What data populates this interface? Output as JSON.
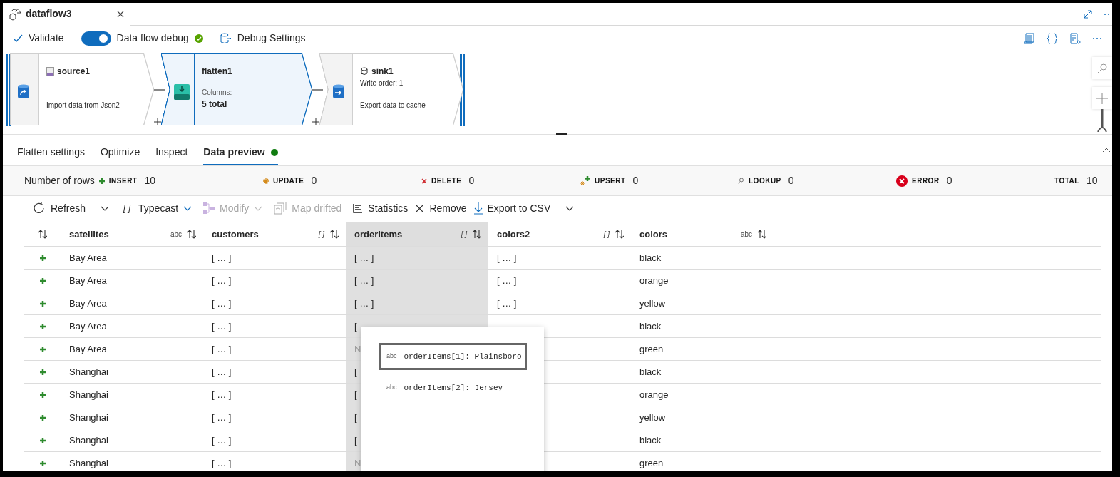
{
  "tab": {
    "title": "dataflow3"
  },
  "toolbar": {
    "validate": "Validate",
    "debug": {
      "label": "Data flow debug",
      "on": true
    },
    "settings": "Debug Settings"
  },
  "canvas": {
    "nodes": [
      {
        "kind": "source",
        "name": "source1",
        "note": "Import data from Json2",
        "selected": false
      },
      {
        "kind": "flatten",
        "name": "flatten1",
        "caption": "Columns:",
        "count": "5 total",
        "selected": true
      },
      {
        "kind": "sink",
        "name": "sink1",
        "subtitle": "Write order: 1",
        "note": "Export data to cache",
        "selected": false
      }
    ]
  },
  "panel_tabs": [
    {
      "label": "Flatten settings",
      "selected": false
    },
    {
      "label": "Optimize",
      "selected": false
    },
    {
      "label": "Inspect",
      "selected": false
    },
    {
      "label": "Data preview",
      "selected": true,
      "succeeded": true
    }
  ],
  "stats": {
    "label": "Number of rows",
    "items": [
      {
        "kind": "insert",
        "label": "INSERT",
        "value": "10"
      },
      {
        "kind": "update",
        "label": "UPDATE",
        "value": "0"
      },
      {
        "kind": "delete",
        "label": "DELETE",
        "value": "0"
      },
      {
        "kind": "upsert",
        "label": "UPSERT",
        "value": "0"
      },
      {
        "kind": "lookup",
        "label": "LOOKUP",
        "value": "0"
      },
      {
        "kind": "error",
        "label": "ERROR",
        "value": "0"
      },
      {
        "kind": "total",
        "label": "TOTAL",
        "value": "10"
      }
    ]
  },
  "preview_toolbar": [
    {
      "kind": "refresh",
      "label": "Refresh",
      "disabled": false,
      "caret": true,
      "separator": true
    },
    {
      "kind": "typecast",
      "glyph": "[ ]",
      "label": "Typecast",
      "disabled": false,
      "caret": true,
      "separator": false
    },
    {
      "kind": "modify",
      "label": "Modify",
      "disabled": true,
      "caret": true,
      "separator": false
    },
    {
      "kind": "map",
      "label": "Map drifted",
      "disabled": true
    },
    {
      "kind": "statistics",
      "label": "Statistics",
      "disabled": false
    },
    {
      "kind": "remove",
      "label": "Remove",
      "disabled": false
    },
    {
      "kind": "export",
      "label": "Export to CSV",
      "disabled": false,
      "caret": true,
      "separator": true
    }
  ],
  "table": {
    "columns": [
      {
        "label": "satellites",
        "type": "abc",
        "selected": false
      },
      {
        "label": "customers",
        "type": "[ ]",
        "selected": false
      },
      {
        "label": "orderItems",
        "type": "[ ]",
        "selected": true
      },
      {
        "label": "colors2",
        "type": "[ ]",
        "selected": false
      },
      {
        "label": "colors",
        "type": "abc",
        "selected": false
      }
    ],
    "rows": [
      {
        "kind": "insert",
        "cells": [
          "Bay Area",
          "[ … ]",
          "[ … ]",
          "[ … ]",
          "black"
        ]
      },
      {
        "kind": "insert",
        "cells": [
          "Bay Area",
          "[ … ]",
          "[ … ]",
          "[ … ]",
          "orange"
        ]
      },
      {
        "kind": "insert",
        "cells": [
          "Bay Area",
          "[ … ]",
          "[ … ]",
          "[ … ]",
          "yellow"
        ]
      },
      {
        "kind": "insert",
        "cells": [
          "Bay Area",
          "[ … ]",
          "[",
          null,
          "black"
        ]
      },
      {
        "kind": "insert",
        "cells": [
          "Bay Area",
          "[ … ]",
          "N",
          null,
          "green"
        ]
      },
      {
        "kind": "insert",
        "cells": [
          "Shanghai",
          "[ … ]",
          "[",
          null,
          "black"
        ]
      },
      {
        "kind": "insert",
        "cells": [
          "Shanghai",
          "[ … ]",
          "[",
          null,
          "orange"
        ]
      },
      {
        "kind": "insert",
        "cells": [
          "Shanghai",
          "[ … ]",
          "[",
          null,
          "yellow"
        ]
      },
      {
        "kind": "insert",
        "cells": [
          "Shanghai",
          "[ … ]",
          "[",
          null,
          "black"
        ]
      },
      {
        "kind": "insert",
        "cells": [
          "Shanghai",
          "[ … ]",
          "N",
          null,
          "green"
        ]
      }
    ]
  },
  "popup": {
    "items": [
      {
        "type": "abc",
        "text": "orderItems[1]: Plainsboro",
        "selected": true
      },
      {
        "type": "abc",
        "text": "orderItems[2]: Jersey",
        "selected": false
      }
    ]
  }
}
